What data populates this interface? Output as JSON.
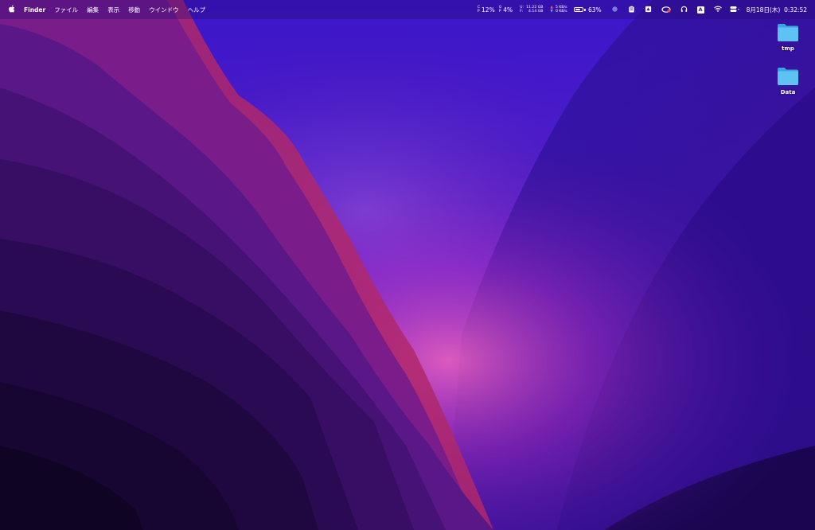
{
  "menubar": {
    "apple_icon": "apple-logo-icon",
    "app_name": "Finder",
    "menus": [
      "ファイル",
      "編集",
      "表示",
      "移動",
      "ウインドウ",
      "ヘルプ"
    ],
    "status": {
      "cpu_label_top": "C",
      "cpu_label_bottom": "P",
      "cpu_percent": "12%",
      "gpu_label_top": "G",
      "gpu_label_bottom": "P",
      "gpu_percent": "4%",
      "mem_used_label": "U:",
      "mem_used": "11.22 GB",
      "mem_free_label": "F:",
      "mem_free": "4.14 GB",
      "net_up": "5 KB/s",
      "net_down": "0 KB/s",
      "battery_percent": "63%",
      "battery_level": 0.63,
      "datetime": "8月18日(木)  0:32:52"
    },
    "icons": [
      "record-dot-icon",
      "clipboard-icon",
      "drive-icon",
      "creative-cloud-icon",
      "headphones-icon",
      "input-method-icon",
      "wifi-icon",
      "control-center-icon"
    ],
    "input_method_label": "A"
  },
  "desktop": {
    "items": [
      {
        "label": "tmp",
        "icon": "folder-icon"
      },
      {
        "label": "Data",
        "icon": "folder-icon"
      }
    ]
  },
  "colors": {
    "folder": "#5ec3f2",
    "folder_dark": "#3aa6e0"
  }
}
